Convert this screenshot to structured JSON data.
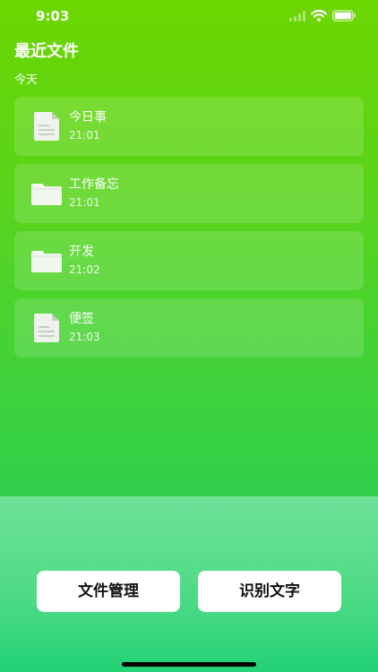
{
  "status_bar": {
    "time": "9:03"
  },
  "header": {
    "title": "最近文件"
  },
  "section": {
    "label": "今天"
  },
  "files": [
    {
      "name": "今日事",
      "time": "21:01",
      "icon": "document-icon"
    },
    {
      "name": "工作备忘",
      "time": "21:01",
      "icon": "folder-icon"
    },
    {
      "name": "开发",
      "time": "21:02",
      "icon": "folder-icon"
    },
    {
      "name": "便签",
      "time": "21:03",
      "icon": "document-icon"
    }
  ],
  "actions": {
    "file_management_label": "文件管理",
    "recognize_text_label": "识别文字"
  },
  "colors": {
    "top_gradient_start": "#6cd600",
    "top_gradient_end": "#2fce4a",
    "bottom_gradient_start": "#6ee198",
    "bottom_gradient_end": "#23d276",
    "button_bg": "#ffffff"
  }
}
